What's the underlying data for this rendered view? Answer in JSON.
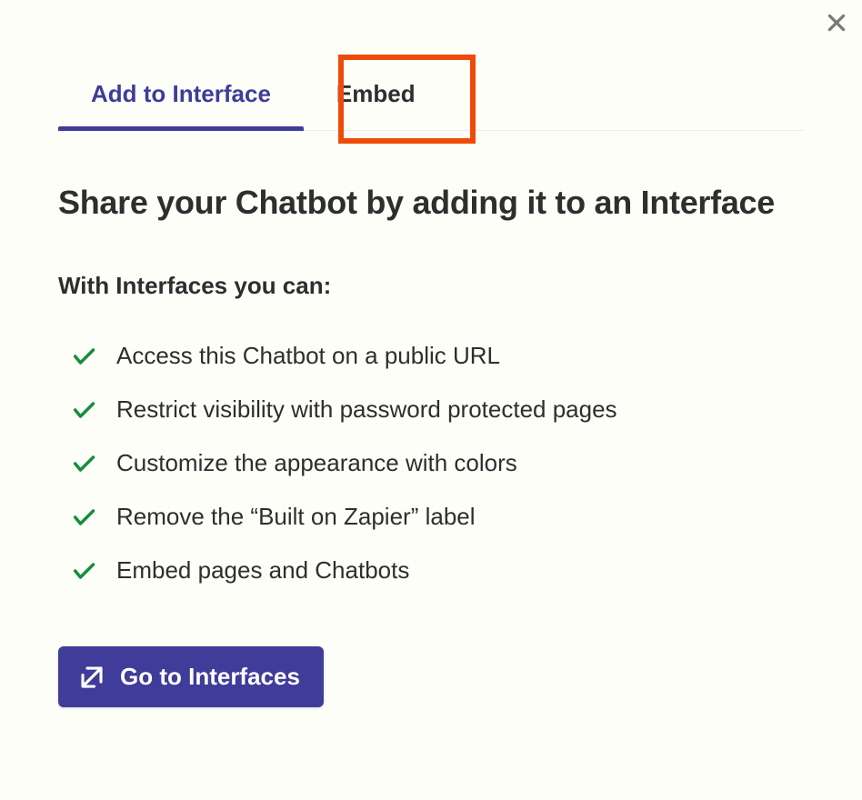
{
  "tabs": {
    "add_to_interface": "Add to Interface",
    "embed": "Embed"
  },
  "content": {
    "heading": "Share your Chatbot by adding it to an Interface",
    "subheading": "With Interfaces you can:",
    "features": [
      "Access this Chatbot on a public URL",
      "Restrict visibility with password protected pages",
      "Customize the appearance with colors",
      "Remove the “Built on Zapier” label",
      "Embed pages and Chatbots"
    ],
    "cta_label": "Go to Interfaces"
  }
}
